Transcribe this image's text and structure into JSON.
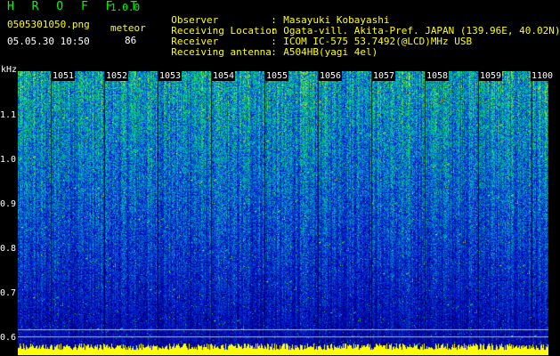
{
  "header": {
    "app_title": "H R O F F T",
    "app_version": "1.0.0",
    "file_name": "0505301050.png",
    "date_time": "05.05.30 10:50",
    "mode_label": "meteor",
    "count_value": "86"
  },
  "info": [
    {
      "label": "Observer",
      "value": "Masayuki Kobayashi"
    },
    {
      "label": "Receiving Location",
      "value": "Ogata-vill. Akita-Pref. JAPAN (139.96E, 40.02N)"
    },
    {
      "label": "Receiver",
      "value": "ICOM IC-575 53.7492(@LCD)MHz USB"
    },
    {
      "label": "Receiving antenna",
      "value": "A504HB(yagi 4el)"
    }
  ],
  "plot": {
    "unit": "kHz",
    "y_ticks": [
      "1.1",
      "1.0",
      "0.9",
      "0.8",
      "0.7",
      "0.6"
    ],
    "x_ticks": [
      "1051",
      "1052",
      "1053",
      "1054",
      "1055",
      "1056",
      "1057",
      "1058",
      "1059",
      "1100"
    ]
  },
  "colors": {
    "header_green": "#00ff00",
    "header_yellow": "#ffff00",
    "background": "#000000"
  }
}
